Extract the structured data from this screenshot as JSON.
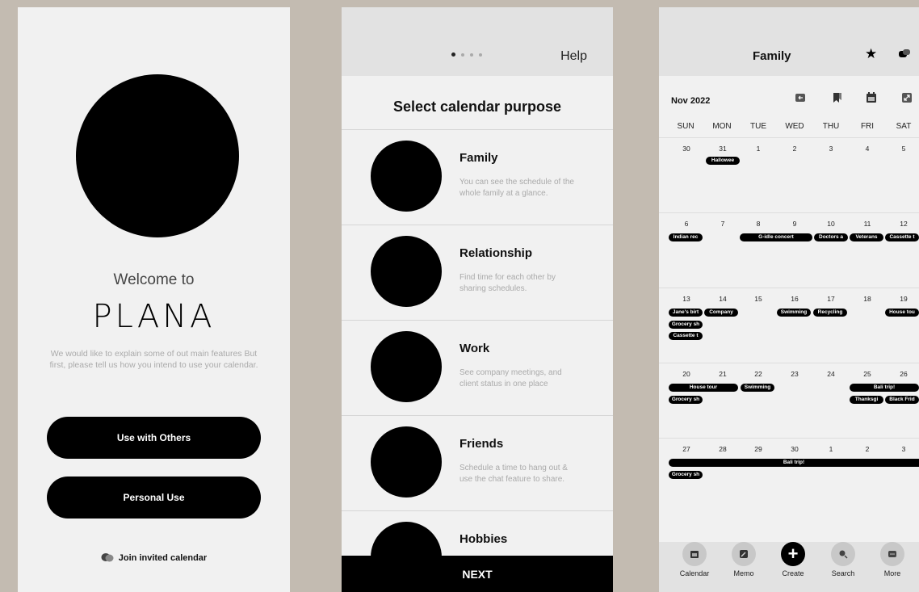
{
  "screen1": {
    "welcome": "Welcome to",
    "logo": "PLANA",
    "intro": "We would like to explain some of out main features But first, please tell us how you intend to use your calendar.",
    "btn_others": "Use with Others",
    "btn_personal": "Personal Use",
    "join": "Join invited calendar"
  },
  "screen2": {
    "help": "Help",
    "title": "Select calendar purpose",
    "items": [
      {
        "name": "Family",
        "desc": "You can see the schedule of the whole family at a glance."
      },
      {
        "name": "Relationship",
        "desc": "Find time for each other by sharing schedules."
      },
      {
        "name": "Work",
        "desc": "See company meetings, and client status in one place"
      },
      {
        "name": "Friends",
        "desc": "Schedule a time to hang out & use the chat feature to share."
      },
      {
        "name": "Hobbies",
        "desc": ""
      }
    ],
    "next": "NEXT"
  },
  "screen3": {
    "title": "Family",
    "month": "Nov 2022",
    "days": [
      "SUN",
      "MON",
      "TUE",
      "WED",
      "THU",
      "FRI",
      "SAT"
    ],
    "weeks": [
      [
        "30",
        "31",
        "1",
        "2",
        "3",
        "4",
        "5"
      ],
      [
        "6",
        "7",
        "8",
        "9",
        "10",
        "11",
        "12"
      ],
      [
        "13",
        "14",
        "15",
        "16",
        "17",
        "18",
        "19"
      ],
      [
        "20",
        "21",
        "22",
        "23",
        "24",
        "25",
        "26"
      ],
      [
        "27",
        "28",
        "29",
        "30",
        "1",
        "2",
        "3"
      ]
    ],
    "events": {
      "halloween": "Hallowee",
      "indian": "Indian rec",
      "gidle": "G-idle concert",
      "doctors": "Doctors a",
      "veterans": "Veterans",
      "cassette1": "Cassette t",
      "janes": "Jane's birt",
      "company": "Company",
      "grocery1": "Grocery sh",
      "cassette2": "Cassette t",
      "swimming1": "Swimming",
      "recycling": "Recycling",
      "housetour1": "House tou",
      "housetour2": "House tour",
      "grocery2": "Grocery sh",
      "swimming2": "Swimming",
      "bali1": "Bali trip!",
      "thanks": "Thanksgi",
      "blackfri": "Black Frid",
      "bali2": "Bali trip!",
      "grocery3": "Grocery sh"
    },
    "nav": [
      "Calendar",
      "Memo",
      "Create",
      "Search",
      "More"
    ]
  }
}
